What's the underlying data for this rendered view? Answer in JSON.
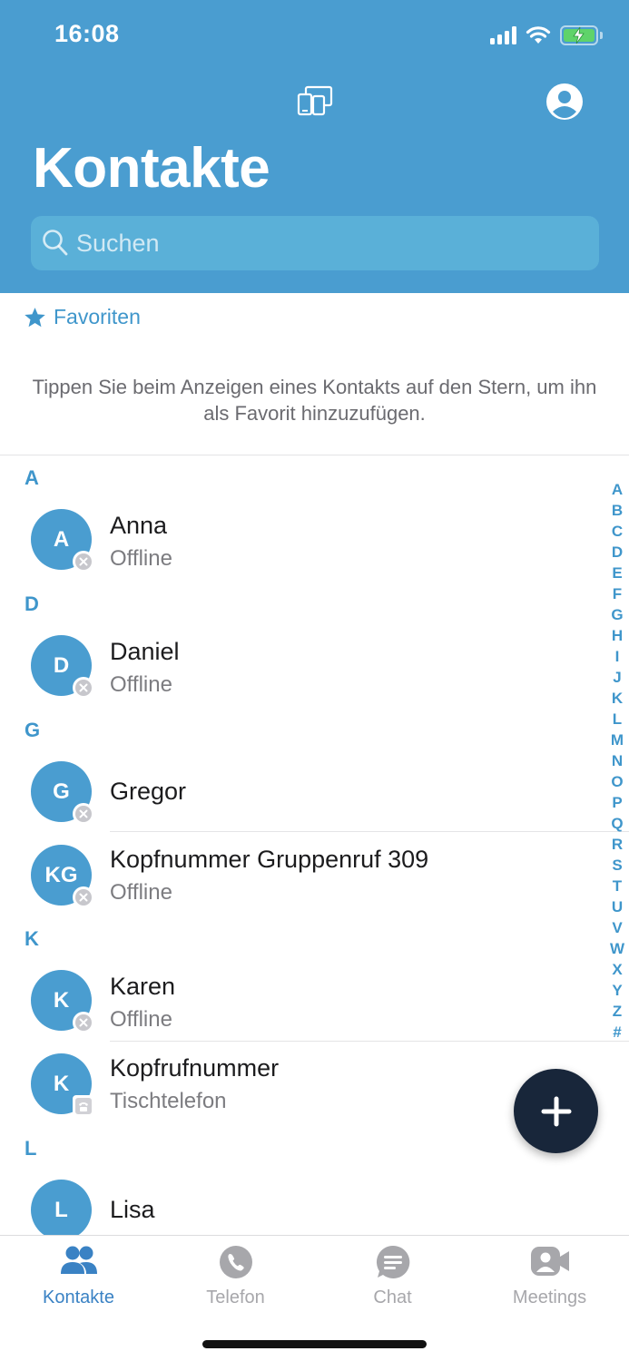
{
  "status_bar": {
    "time": "16:08"
  },
  "header": {
    "title": "Kontakte",
    "search_placeholder": "Suchen"
  },
  "favorites": {
    "label": "Favoriten",
    "hint": "Tippen Sie beim Anzeigen eines Kontakts auf den Stern, um ihn als Favorit hinzuzufügen."
  },
  "sections": [
    {
      "letter": "A",
      "contacts": [
        {
          "initials": "A",
          "name": "Anna",
          "status": "Offline",
          "presence": "offline"
        }
      ]
    },
    {
      "letter": "D",
      "contacts": [
        {
          "initials": "D",
          "name": "Daniel",
          "status": "Offline",
          "presence": "offline"
        }
      ]
    },
    {
      "letter": "G",
      "contacts": [
        {
          "initials": "G",
          "name": "Gregor",
          "status": "",
          "presence": "offline"
        },
        {
          "initials": "KG",
          "name": "Kopfnummer Gruppenruf 309",
          "status": "Offline",
          "presence": "offline"
        }
      ]
    },
    {
      "letter": "K",
      "contacts": [
        {
          "initials": "K",
          "name": "Karen",
          "status": "Offline",
          "presence": "offline"
        },
        {
          "initials": "K",
          "name": "Kopfrufnummer",
          "status": "Tischtelefon",
          "presence": "desk-phone"
        }
      ]
    },
    {
      "letter": "L",
      "contacts": [
        {
          "initials": "L",
          "name": "Lisa",
          "status": "",
          "presence": ""
        }
      ]
    }
  ],
  "alphabet_index": [
    "A",
    "B",
    "C",
    "D",
    "E",
    "F",
    "G",
    "H",
    "I",
    "J",
    "K",
    "L",
    "M",
    "N",
    "O",
    "P",
    "Q",
    "R",
    "S",
    "T",
    "U",
    "V",
    "W",
    "X",
    "Y",
    "Z",
    "#"
  ],
  "tabs": [
    {
      "label": "Kontakte",
      "icon": "contacts-icon",
      "active": true
    },
    {
      "label": "Telefon",
      "icon": "phone-icon",
      "active": false
    },
    {
      "label": "Chat",
      "icon": "chat-icon",
      "active": false
    },
    {
      "label": "Meetings",
      "icon": "meetings-icon",
      "active": false
    }
  ],
  "colors": {
    "header_blue": "#4a9dd0",
    "accent_blue": "#3f96cb",
    "fab_navy": "#18263a",
    "inactive_gray": "#a7a7ab"
  }
}
